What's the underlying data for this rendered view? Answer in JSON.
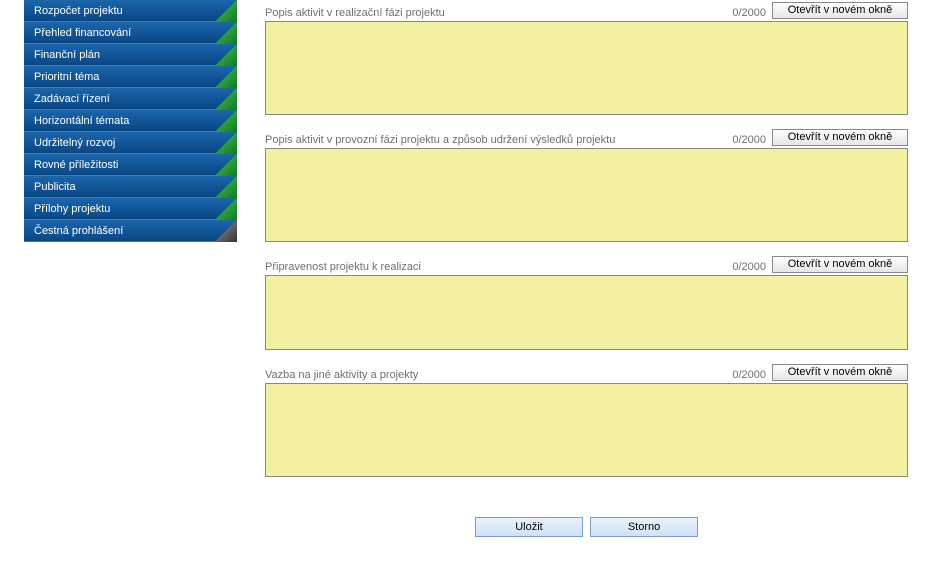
{
  "sidebar": {
    "items": [
      {
        "label": "Rozpočet projektu"
      },
      {
        "label": "Přehled financování"
      },
      {
        "label": "Finanční plán"
      },
      {
        "label": "Prioritní téma"
      },
      {
        "label": "Zadávací řízení"
      },
      {
        "label": "Horizontální témata"
      },
      {
        "label": "Udržitelný rozvoj"
      },
      {
        "label": "Rovné příležitosti"
      },
      {
        "label": "Publicita"
      },
      {
        "label": "Přílohy projektu"
      },
      {
        "label": "Čestná prohlášení"
      }
    ]
  },
  "fields": [
    {
      "label": "Popis aktivit v realizační fázi projektu",
      "counter": "0/2000",
      "button": "Otevřít v novém okně"
    },
    {
      "label": "Popis aktivit v provozní fázi projektu a způsob udržení výsledků projektu",
      "counter": "0/2000",
      "button": "Otevřít v novém okně"
    },
    {
      "label": "Připravenost projektu k realizaci",
      "counter": "0/2000",
      "button": "Otevřít v novém okně"
    },
    {
      "label": "Vazba na jiné aktivity a projekty",
      "counter": "0/2000",
      "button": "Otevřít v novém okně"
    }
  ],
  "footer": {
    "save": "Uložit",
    "cancel": "Storno"
  }
}
